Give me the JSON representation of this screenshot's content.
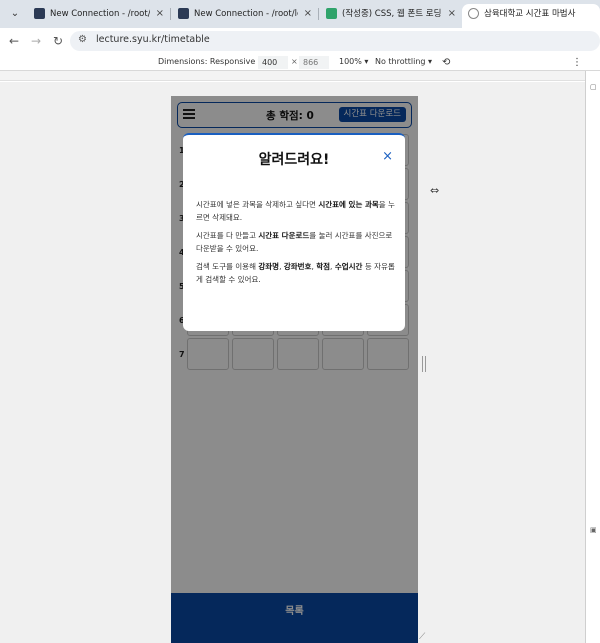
{
  "browser": {
    "tabs": [
      {
        "title": "New Connection - /root/lecture",
        "active": false
      },
      {
        "title": "New Connection - /root/lecture",
        "active": false
      },
      {
        "title": "(작성중) CSS, 웹 폰트 로딩 속도",
        "active": false
      },
      {
        "title": "삼육대학교 시간표 마법사",
        "active": true
      }
    ],
    "close_glyph": "×",
    "url": "lecture.syu.kr/timetable",
    "devtools": {
      "dimensions_label": "Dimensions: Responsive",
      "width": "400",
      "times": "×",
      "height": "866",
      "zoom": "100%",
      "throttling": "No throttling"
    }
  },
  "app": {
    "header": {
      "credits_label": "총 학점: 0",
      "download_button": "시간표 다운로드"
    },
    "grid": {
      "periods": [
        "1",
        "2",
        "3",
        "4",
        "5",
        "6",
        "7"
      ]
    },
    "list_button": "목록",
    "modal": {
      "title": "알려드려요!",
      "close_glyph": "×",
      "p1": [
        "시간표에 넣은 과목을 삭제하고 싶다면 ",
        "시간표에 있는 과목",
        "을 누르면 삭제돼요."
      ],
      "p2": [
        "시간표를 다 만들고 ",
        "시간표 다운로드",
        "를 눌러 시간표를 사진으로 다운받을 수 있어요."
      ],
      "p3": [
        "검색 도구를 이용해 ",
        "강좌명",
        ", ",
        "강좌번호",
        ", ",
        "학점",
        ", ",
        "수업시간",
        " 등 자유롭게 검색할 수 있어요."
      ]
    }
  },
  "colors": {
    "brand": "#0a4aa6",
    "modal_accent": "#1a5fc0",
    "overlay": "rgba(0,0,0,0.45)"
  }
}
